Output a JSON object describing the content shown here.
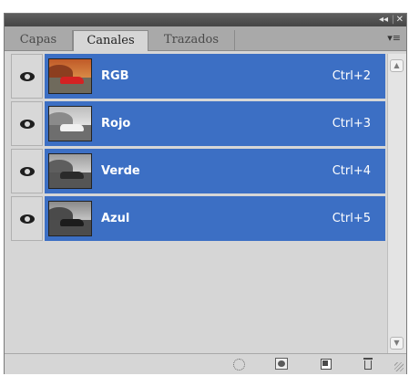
{
  "window": {
    "collapse_icon": "◂◂",
    "close_icon": "✕"
  },
  "tabs": [
    {
      "label": "Capas"
    },
    {
      "label": "Canales",
      "active": true
    },
    {
      "label": "Trazados"
    }
  ],
  "panel_menu_icon": "▾≡",
  "channels": [
    {
      "name": "RGB",
      "shortcut": "Ctrl+2",
      "visible": true,
      "selected": true,
      "thumbnail": "color"
    },
    {
      "name": "Rojo",
      "shortcut": "Ctrl+3",
      "visible": true,
      "selected": true,
      "thumbnail": "grayscale-light"
    },
    {
      "name": "Verde",
      "shortcut": "Ctrl+4",
      "visible": true,
      "selected": true,
      "thumbnail": "grayscale"
    },
    {
      "name": "Azul",
      "shortcut": "Ctrl+5",
      "visible": true,
      "selected": true,
      "thumbnail": "grayscale-dark"
    }
  ],
  "bottom_buttons": [
    {
      "name": "load-channel-as-selection-icon"
    },
    {
      "name": "save-selection-as-channel-icon"
    },
    {
      "name": "new-channel-icon"
    },
    {
      "name": "delete-channel-icon"
    }
  ],
  "colors": {
    "selection": "#3c6fc4",
    "panel": "#d6d6d6",
    "tabbar": "#a9a9a9",
    "titlebar": "#4f4f4f"
  }
}
